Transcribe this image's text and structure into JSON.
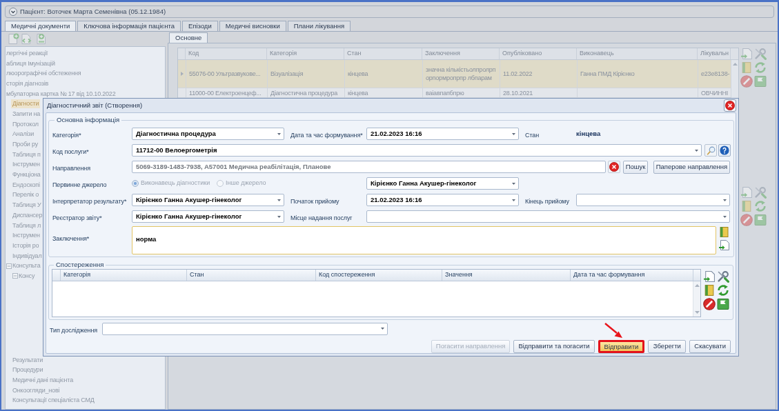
{
  "patient_header": {
    "title": "Пацієнт: Воточек Марта Семенівна (05.12.1984)"
  },
  "tabs": [
    {
      "label": "Медичні документи",
      "selected": true
    },
    {
      "label": "Ключова інформація пацієнта",
      "selected": false
    },
    {
      "label": "Епізоди",
      "selected": false
    },
    {
      "label": "Медичні висновки",
      "selected": false
    },
    {
      "label": "Плани лікування",
      "selected": false
    }
  ],
  "sidebar": {
    "items": [
      {
        "label": "лергічні реакції",
        "selected": false
      },
      {
        "label": "аблиця Імунізацій",
        "selected": false
      },
      {
        "label": "люорографічні обстеження",
        "selected": false
      },
      {
        "label": "сторія діагнозів",
        "selected": false
      },
      {
        "label": "мбулаторна картка № 17 від 10.10.2022",
        "selected": false,
        "children": [
          {
            "label": "Діагности",
            "selected": true
          },
          {
            "label": "Запити на",
            "selected": false
          },
          {
            "label": "Протокол",
            "selected": false
          },
          {
            "label": "Аналізи",
            "selected": false
          },
          {
            "label": "Проби ру",
            "selected": false
          },
          {
            "label": "Таблиця п",
            "selected": false
          },
          {
            "label": "Інструмен",
            "selected": false
          },
          {
            "label": "Функціона",
            "selected": false
          },
          {
            "label": "Ендоскопі",
            "selected": false
          },
          {
            "label": "Перелік о",
            "selected": false
          },
          {
            "label": "Таблиця У",
            "selected": false
          },
          {
            "label": "Диспансер",
            "selected": false
          },
          {
            "label": "Таблиця л",
            "selected": false
          },
          {
            "label": "Інструмен",
            "selected": false
          },
          {
            "label": "Історія ро",
            "selected": false
          },
          {
            "label": "Індивідуал",
            "selected": false
          },
          {
            "label": "Консульта",
            "selected": false,
            "expanded": true,
            "children": [
              {
                "label": "Консу",
                "selected": false,
                "expanded": true
              }
            ]
          },
          {
            "label": "Результати",
            "selected": false
          },
          {
            "label": "Процедури",
            "selected": false
          },
          {
            "label": "Медичні дані пацієнта",
            "selected": false
          },
          {
            "label": "Онкоогляди_нові",
            "selected": false
          },
          {
            "label": "Консультації спеціаліста СМД",
            "selected": false
          }
        ]
      }
    ]
  },
  "subtabs": [
    {
      "label": "Основне",
      "selected": true
    }
  ],
  "documents_table": {
    "columns": [
      "Код",
      "Категорія",
      "Стан",
      "Заключення",
      "Опубліковано",
      "Виконавець",
      "Лікувальн"
    ],
    "rows": [
      {
        "selected": true,
        "cells": {
          "code": "55076-00 Ультразвукове...",
          "category": "Візуалізація",
          "status": "кінцева",
          "conclusion": "значна кількістьолпролрп орпормропрпр лбпарам",
          "published": "11.02.2022",
          "performer": "Ганна ПМД Кірієнко",
          "column_7": "e23e8138-"
        }
      },
      {
        "selected": false,
        "cells": {
          "code": "11000-00 Електроенцеф...",
          "category": "Діагностична процедура",
          "status": "кінцева",
          "conclusion": "ваіавпапбпрю",
          "published": "28.10.2021",
          "column_7": "ОВЧИННІ"
        }
      }
    ]
  },
  "dialog": {
    "title": "Діагностичний звіт (Створення)",
    "main_info": {
      "title": "Основна інформація",
      "category": {
        "label": "Категорія*",
        "value": "Діагностична процедура"
      },
      "formed_at": {
        "label": "Дата та час формування*",
        "value": "21.02.2023 16:16"
      },
      "status": {
        "label": "Стан",
        "value": "кінцева"
      },
      "service_code": {
        "label": "Код послуги*",
        "value": "11712-00 Велоергометрія"
      },
      "referral": {
        "label": "Направлення",
        "value": "5069-3189-1483-7938, A57001 Медична реабілітація, Планове",
        "disabled": true
      },
      "search_button": "Пошук",
      "paper_referral_button": "Паперове направлення",
      "primary_source": {
        "label": "Первинне джерело",
        "disabled": true,
        "options": [
          {
            "label": "Виконавець діагностики",
            "selected": true
          },
          {
            "label": "Інше джерело",
            "selected": false
          }
        ],
        "value": "Кірієнко Ганна Акушер-гінеколог"
      },
      "interpreter": {
        "label": "Інтерпретатор результату*",
        "value": "Кірієнко Ганна Акушер-гінеколог"
      },
      "visit_start": {
        "label": "Початок прийому",
        "value": "21.02.2023 16:16"
      },
      "visit_end": {
        "label": "Кінець прийому"
      },
      "registrar": {
        "label": "Реєстратор звіту*",
        "value": "Кірієнко Ганна Акушер-гінеколог"
      },
      "service_place": {
        "label": "Місце надання послуг"
      },
      "conclusion": {
        "label": "Заключення*",
        "value": "норма"
      }
    },
    "observations": {
      "title": "Спостереження",
      "columns": [
        "Категорія",
        "Стан",
        "Код спостереження",
        "Значення",
        "Дата та час формування"
      ]
    },
    "study_type": {
      "label": "Тип дослідження"
    },
    "buttons": [
      {
        "label": "Погасити направлення",
        "disabled": true,
        "highlighted": false
      },
      {
        "label": "Відправити та погасити",
        "disabled": false,
        "highlighted": false
      },
      {
        "label": "Відправити",
        "disabled": false,
        "highlighted": true
      },
      {
        "label": "Зберегти",
        "disabled": false,
        "highlighted": false
      },
      {
        "label": "Скасувати",
        "disabled": false,
        "highlighted": false
      }
    ]
  }
}
